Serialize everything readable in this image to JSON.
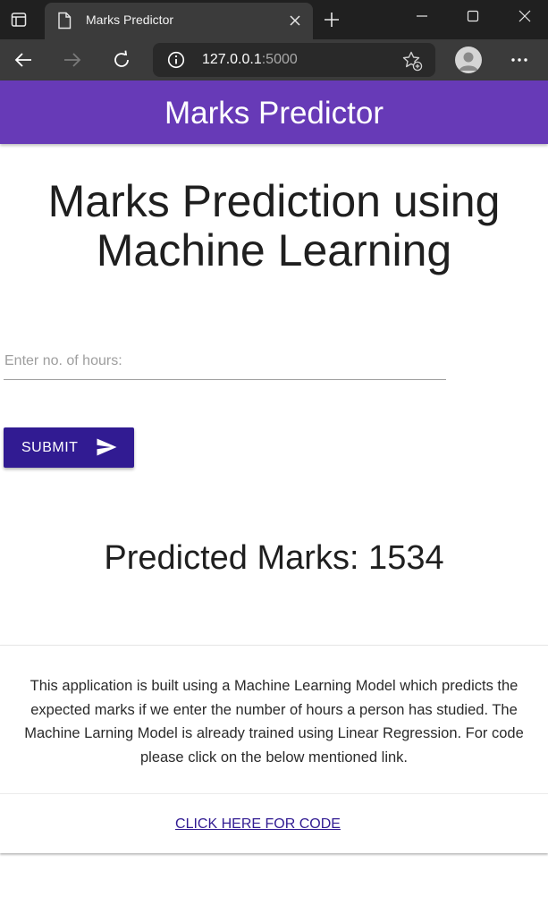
{
  "browser": {
    "tab": {
      "title": "Marks Predictor"
    },
    "address": {
      "host": "127.0.0.1",
      "port": ":5000"
    }
  },
  "app": {
    "header_title": "Marks Predictor",
    "page_title": "Marks Prediction using Machine Learning",
    "hours_input": {
      "placeholder": "Enter no. of hours:",
      "value": ""
    },
    "submit_label": "SUBMIT",
    "prediction_text": "Predicted Marks: 1534",
    "description": "This application is built using a Machine Learning Model which predicts the expected marks if we enter the number of hours a person has studied. The Machine Larning Model is already trained using Linear Regression. For code please click on the below mentioned link.",
    "code_link_label": "CLICK HERE FOR CODE"
  },
  "colors": {
    "header": "#673ab7",
    "button": "#311b92",
    "link": "#311b92",
    "browser_frame": "#202020",
    "browser_toolbar": "#3b3b3b"
  },
  "icons": [
    "window-icon",
    "page-icon",
    "close-icon",
    "plus-icon",
    "minimize-icon",
    "maximize-icon",
    "back-icon",
    "forward-icon",
    "refresh-icon",
    "info-icon",
    "favorites-add-icon",
    "profile-icon",
    "more-icon",
    "send-icon"
  ]
}
